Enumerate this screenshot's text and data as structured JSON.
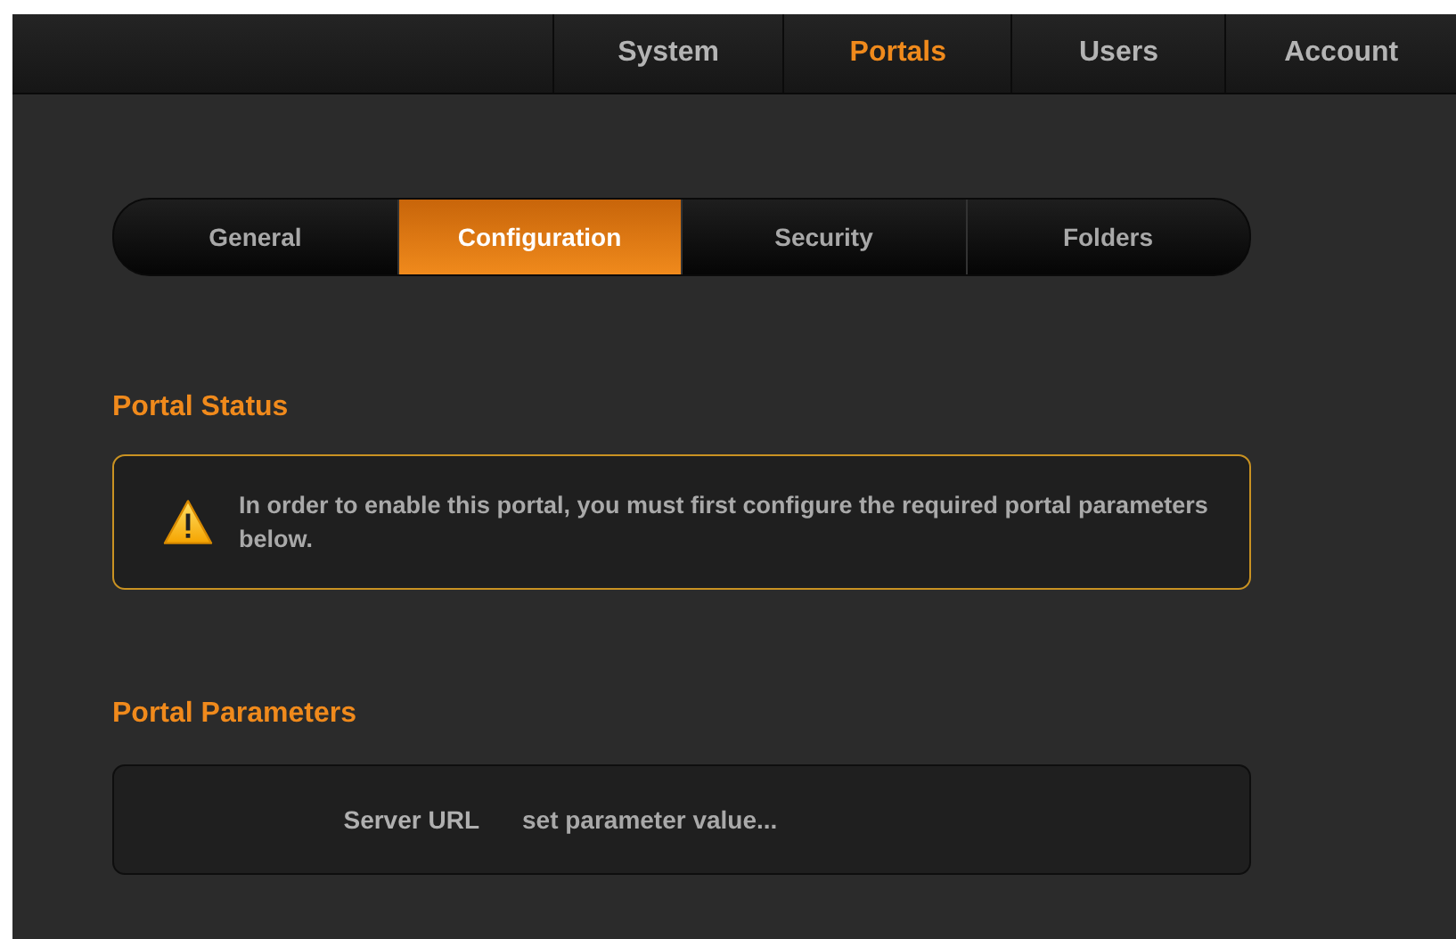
{
  "nav": [
    {
      "label": "System",
      "selected": false
    },
    {
      "label": "Portals",
      "selected": true
    },
    {
      "label": "Users",
      "selected": false
    },
    {
      "label": "Account",
      "selected": false
    }
  ],
  "tabs": [
    {
      "label": "General",
      "selected": false
    },
    {
      "label": "Configuration",
      "selected": true
    },
    {
      "label": "Security",
      "selected": false
    },
    {
      "label": "Folders",
      "selected": false
    }
  ],
  "status": {
    "heading": "Portal Status",
    "message": "In order to enable this portal, you must first configure the required portal parameters below."
  },
  "parameters": {
    "heading": "Portal Parameters",
    "fields": [
      {
        "label": "Server URL",
        "placeholder": "set parameter value..."
      }
    ]
  }
}
